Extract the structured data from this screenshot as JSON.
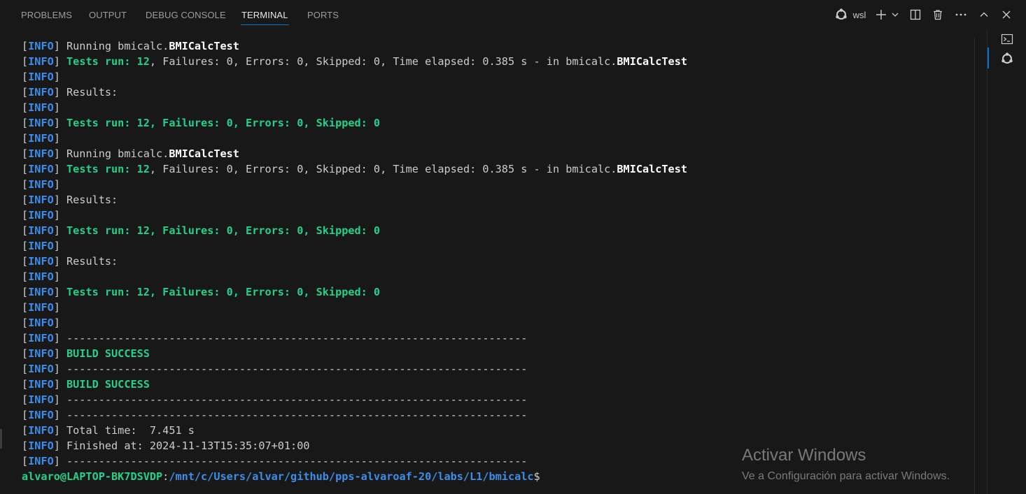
{
  "tabs": [
    {
      "label": "PROBLEMS",
      "active": false
    },
    {
      "label": "OUTPUT",
      "active": false
    },
    {
      "label": "DEBUG CONSOLE",
      "active": false
    },
    {
      "label": "TERMINAL",
      "active": true
    },
    {
      "label": "PORTS",
      "active": false
    }
  ],
  "toolbar": {
    "profile_label": "wsl",
    "profile_icon": "ubuntu-icon",
    "new_terminal_icon": "plus-icon",
    "dropdown_icon": "chevron-down-icon",
    "split_icon": "split-editor-icon",
    "kill_icon": "trash-icon",
    "more_icon": "ellipsis-icon",
    "maximize_icon": "chevron-up-icon",
    "close_icon": "close-icon"
  },
  "colors": {
    "background": "#181818",
    "info_level": "#3b8eea",
    "success": "#23d18b",
    "text": "#cccccc",
    "accent": "#0078d4"
  },
  "terminal": {
    "lines": [
      [
        {
          "t": "[",
          "c": "bk"
        },
        {
          "t": "INFO",
          "c": "lvl"
        },
        {
          "t": "] Running bmicalc.",
          "c": "bk"
        },
        {
          "t": "BMICalcTest",
          "c": "wb"
        }
      ],
      [
        {
          "t": "[",
          "c": "bk"
        },
        {
          "t": "INFO",
          "c": "lvl"
        },
        {
          "t": "] ",
          "c": "bk"
        },
        {
          "t": "Tests run: 12",
          "c": "g"
        },
        {
          "t": ", Failures: 0, Errors: 0, Skipped: 0, Time elapsed: 0.385 s - in bmicalc.",
          "c": "bk"
        },
        {
          "t": "BMICalcTest",
          "c": "wb"
        }
      ],
      [
        {
          "t": "[",
          "c": "bk"
        },
        {
          "t": "INFO",
          "c": "lvl"
        },
        {
          "t": "]",
          "c": "bk"
        }
      ],
      [
        {
          "t": "[",
          "c": "bk"
        },
        {
          "t": "INFO",
          "c": "lvl"
        },
        {
          "t": "] Results:",
          "c": "bk"
        }
      ],
      [
        {
          "t": "[",
          "c": "bk"
        },
        {
          "t": "INFO",
          "c": "lvl"
        },
        {
          "t": "]",
          "c": "bk"
        }
      ],
      [
        {
          "t": "[",
          "c": "bk"
        },
        {
          "t": "INFO",
          "c": "lvl"
        },
        {
          "t": "] ",
          "c": "bk"
        },
        {
          "t": "Tests run: 12, Failures: 0, Errors: 0, Skipped: 0",
          "c": "g"
        }
      ],
      [
        {
          "t": "[",
          "c": "bk"
        },
        {
          "t": "INFO",
          "c": "lvl"
        },
        {
          "t": "]",
          "c": "bk"
        }
      ],
      [
        {
          "t": "[",
          "c": "bk"
        },
        {
          "t": "INFO",
          "c": "lvl"
        },
        {
          "t": "] Running bmicalc.",
          "c": "bk"
        },
        {
          "t": "BMICalcTest",
          "c": "wb"
        }
      ],
      [
        {
          "t": "[",
          "c": "bk"
        },
        {
          "t": "INFO",
          "c": "lvl"
        },
        {
          "t": "] ",
          "c": "bk"
        },
        {
          "t": "Tests run: 12",
          "c": "g"
        },
        {
          "t": ", Failures: 0, Errors: 0, Skipped: 0, Time elapsed: 0.385 s - in bmicalc.",
          "c": "bk"
        },
        {
          "t": "BMICalcTest",
          "c": "wb"
        }
      ],
      [
        {
          "t": "[",
          "c": "bk"
        },
        {
          "t": "INFO",
          "c": "lvl"
        },
        {
          "t": "]",
          "c": "bk"
        }
      ],
      [
        {
          "t": "[",
          "c": "bk"
        },
        {
          "t": "INFO",
          "c": "lvl"
        },
        {
          "t": "] Results:",
          "c": "bk"
        }
      ],
      [
        {
          "t": "[",
          "c": "bk"
        },
        {
          "t": "INFO",
          "c": "lvl"
        },
        {
          "t": "]",
          "c": "bk"
        }
      ],
      [
        {
          "t": "[",
          "c": "bk"
        },
        {
          "t": "INFO",
          "c": "lvl"
        },
        {
          "t": "] ",
          "c": "bk"
        },
        {
          "t": "Tests run: 12, Failures: 0, Errors: 0, Skipped: 0",
          "c": "g"
        }
      ],
      [
        {
          "t": "[",
          "c": "bk"
        },
        {
          "t": "INFO",
          "c": "lvl"
        },
        {
          "t": "]",
          "c": "bk"
        }
      ],
      [
        {
          "t": "[",
          "c": "bk"
        },
        {
          "t": "INFO",
          "c": "lvl"
        },
        {
          "t": "] Results:",
          "c": "bk"
        }
      ],
      [
        {
          "t": "[",
          "c": "bk"
        },
        {
          "t": "INFO",
          "c": "lvl"
        },
        {
          "t": "]",
          "c": "bk"
        }
      ],
      [
        {
          "t": "[",
          "c": "bk"
        },
        {
          "t": "INFO",
          "c": "lvl"
        },
        {
          "t": "] ",
          "c": "bk"
        },
        {
          "t": "Tests run: 12, Failures: 0, Errors: 0, Skipped: 0",
          "c": "g"
        }
      ],
      [
        {
          "t": "[",
          "c": "bk"
        },
        {
          "t": "INFO",
          "c": "lvl"
        },
        {
          "t": "]",
          "c": "bk"
        }
      ],
      [
        {
          "t": "[",
          "c": "bk"
        },
        {
          "t": "INFO",
          "c": "lvl"
        },
        {
          "t": "]",
          "c": "bk"
        }
      ],
      [
        {
          "t": "[",
          "c": "bk"
        },
        {
          "t": "INFO",
          "c": "lvl"
        },
        {
          "t": "] ------------------------------------------------------------------------",
          "c": "bk"
        }
      ],
      [
        {
          "t": "[",
          "c": "bk"
        },
        {
          "t": "INFO",
          "c": "lvl"
        },
        {
          "t": "] ",
          "c": "bk"
        },
        {
          "t": "BUILD SUCCESS",
          "c": "g"
        }
      ],
      [
        {
          "t": "[",
          "c": "bk"
        },
        {
          "t": "INFO",
          "c": "lvl"
        },
        {
          "t": "] ------------------------------------------------------------------------",
          "c": "bk"
        }
      ],
      [
        {
          "t": "[",
          "c": "bk"
        },
        {
          "t": "INFO",
          "c": "lvl"
        },
        {
          "t": "] ",
          "c": "bk"
        },
        {
          "t": "BUILD SUCCESS",
          "c": "g"
        }
      ],
      [
        {
          "t": "[",
          "c": "bk"
        },
        {
          "t": "INFO",
          "c": "lvl"
        },
        {
          "t": "] ------------------------------------------------------------------------",
          "c": "bk"
        }
      ],
      [
        {
          "t": "[",
          "c": "bk"
        },
        {
          "t": "INFO",
          "c": "lvl"
        },
        {
          "t": "] ------------------------------------------------------------------------",
          "c": "bk"
        }
      ],
      [
        {
          "t": "[",
          "c": "bk"
        },
        {
          "t": "INFO",
          "c": "lvl"
        },
        {
          "t": "] Total time:  7.451 s",
          "c": "bk"
        }
      ],
      [
        {
          "t": "[",
          "c": "bk"
        },
        {
          "t": "INFO",
          "c": "lvl"
        },
        {
          "t": "] Finished at: 2024-11-13T15:35:07+01:00",
          "c": "bk"
        }
      ],
      [
        {
          "t": "[",
          "c": "bk"
        },
        {
          "t": "INFO",
          "c": "lvl"
        },
        {
          "t": "] ------------------------------------------------------------------------",
          "c": "bk"
        }
      ]
    ],
    "prompt": {
      "user_host": "alvaro@LAPTOP-BK7DSVDP",
      "separator": ":",
      "path": "/mnt/c/Users/alvar/github/pps-alvaroaf-20/labs/L1/bmicalc",
      "symbol": "$"
    }
  },
  "right_panel": {
    "items": [
      {
        "icon": "terminal-icon",
        "active": true
      },
      {
        "icon": "ubuntu-icon",
        "active": false
      }
    ]
  },
  "watermark": {
    "title": "Activar Windows",
    "subtitle": "Ve a Configuración para activar Windows."
  }
}
